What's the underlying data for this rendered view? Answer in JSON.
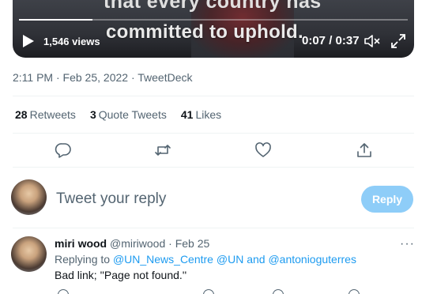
{
  "video": {
    "caption_top": "that every country has",
    "caption": "committed to uphold.",
    "views": "1,546 views",
    "time": "0:07 / 0:37",
    "progress": 0.19
  },
  "meta": {
    "timestamp": "2:11 PM · Feb 25, 2022 · TweetDeck"
  },
  "stats": {
    "retweets_count": "28",
    "retweets_label": "Retweets",
    "quotes_count": "3",
    "quotes_label": "Quote Tweets",
    "likes_count": "41",
    "likes_label": "Likes"
  },
  "actions": [
    "reply-icon",
    "retweet-icon",
    "like-icon",
    "share-icon"
  ],
  "composer": {
    "placeholder": "Tweet your reply",
    "button": "Reply"
  },
  "reply": {
    "name": "miri wood",
    "handle": "@miriwood",
    "sep": "·",
    "date": "Feb 25",
    "more": "···",
    "replying_prefix": "Replying to",
    "mention_1": "@UN_News_Centre",
    "mention_2": "@UN",
    "and": "and",
    "mention_3": "@antonioguterres",
    "text": "Bad link; ''Page not found.''"
  },
  "colors": {
    "accent": "#1d9bf0",
    "reply_button": "#8ecdf8",
    "muted": "#536471"
  }
}
